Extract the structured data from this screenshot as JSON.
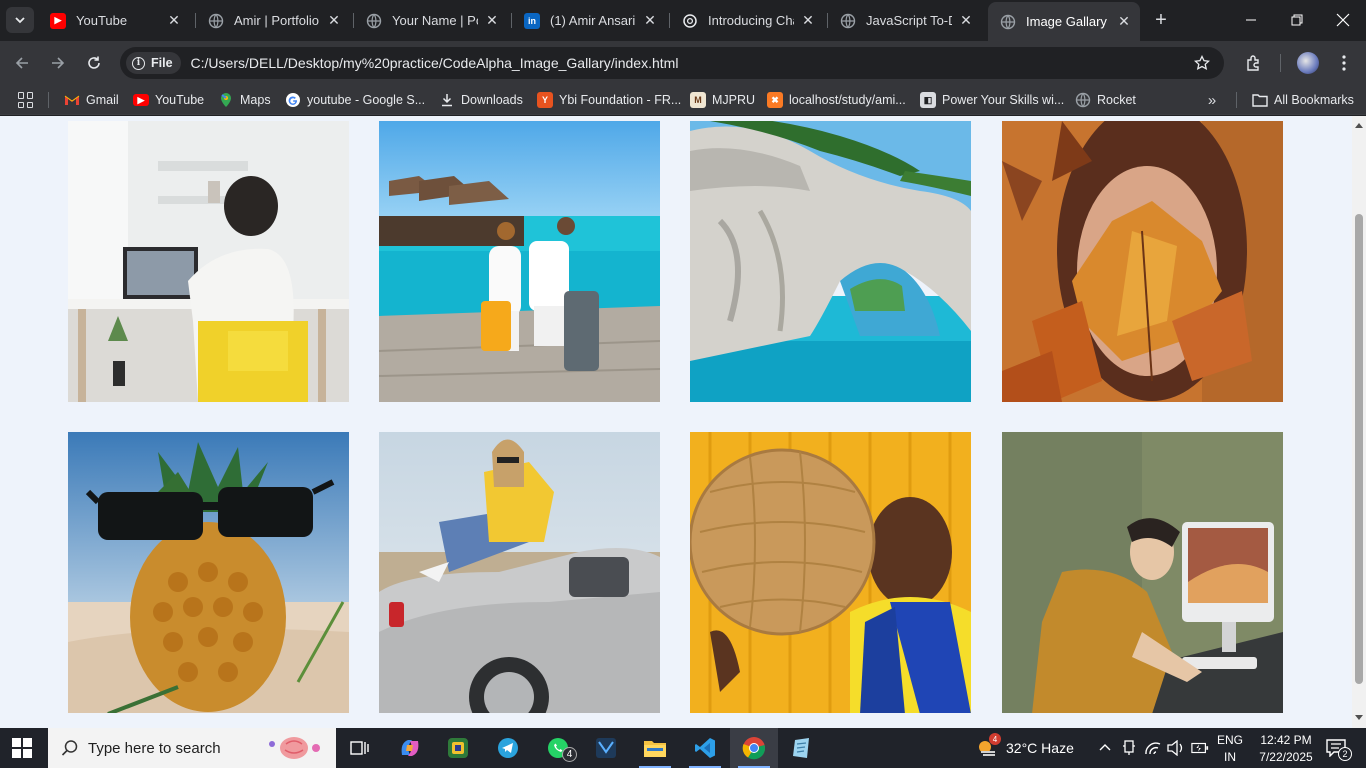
{
  "browser": {
    "tabs": [
      {
        "title": "YouTube",
        "favicon": "youtube-icon",
        "color": "#ff0000",
        "active": false
      },
      {
        "title": "Amir | Portfolio",
        "favicon": "globe-icon",
        "color": "#9aa0a6",
        "active": false
      },
      {
        "title": "Your Name | Por",
        "favicon": "globe-icon",
        "color": "#9aa0a6",
        "active": false
      },
      {
        "title": "(1) Amir Ansari |",
        "favicon": "linkedin-icon",
        "color": "#0a66c2",
        "active": false
      },
      {
        "title": "Introducing Cha",
        "favicon": "openai-icon",
        "color": "#e8eaed",
        "active": false
      },
      {
        "title": "JavaScript To-Do",
        "favicon": "globe-icon",
        "color": "#9aa0a6",
        "active": false
      },
      {
        "title": "Image Gallary",
        "favicon": "globe-icon",
        "color": "#9aa0a6",
        "active": true
      }
    ],
    "address": {
      "chip": "File",
      "url": "C:/Users/DELL/Desktop/my%20practice/CodeAlpha_Image_Gallary/index.html"
    },
    "bookmarks": [
      {
        "label": "Gmail",
        "icon": "gmail-icon"
      },
      {
        "label": "YouTube",
        "icon": "youtube-icon"
      },
      {
        "label": "Maps",
        "icon": "maps-icon"
      },
      {
        "label": "youtube - Google S...",
        "icon": "google-icon"
      },
      {
        "label": "Downloads",
        "icon": "download-icon"
      },
      {
        "label": "Ybi Foundation - FR...",
        "icon": "ybi-icon"
      },
      {
        "label": "MJPRU",
        "icon": "mjpru-icon"
      },
      {
        "label": "localhost/study/ami...",
        "icon": "xampp-icon"
      },
      {
        "label": "Power Your Skills wi...",
        "icon": "skills-icon"
      },
      {
        "label": "Rocket",
        "icon": "globe-icon"
      }
    ],
    "all_bookmarks": "All Bookmarks"
  },
  "gallery": {
    "images": [
      {
        "subject": "person at laptop desk",
        "name": "gallery-image-desk"
      },
      {
        "subject": "couple with luggage on pier",
        "name": "gallery-image-pier"
      },
      {
        "subject": "sea arch cliff",
        "name": "gallery-image-arch"
      },
      {
        "subject": "woman with autumn leaves",
        "name": "gallery-image-leaves"
      },
      {
        "subject": "pineapple with sunglasses",
        "name": "gallery-image-pineapple"
      },
      {
        "subject": "woman on convertible car",
        "name": "gallery-image-car"
      },
      {
        "subject": "woman with woven hat",
        "name": "gallery-image-hat"
      },
      {
        "subject": "man writing at computer",
        "name": "gallery-image-writing"
      }
    ]
  },
  "taskbar": {
    "search_placeholder": "Type here to search",
    "weather": "32°C  Haze",
    "lang_top": "ENG",
    "lang_bottom": "IN",
    "time": "12:42 PM",
    "date": "7/22/2025",
    "whatsapp_badge": "4",
    "notification_badge": "2",
    "weather_badge": "4"
  }
}
